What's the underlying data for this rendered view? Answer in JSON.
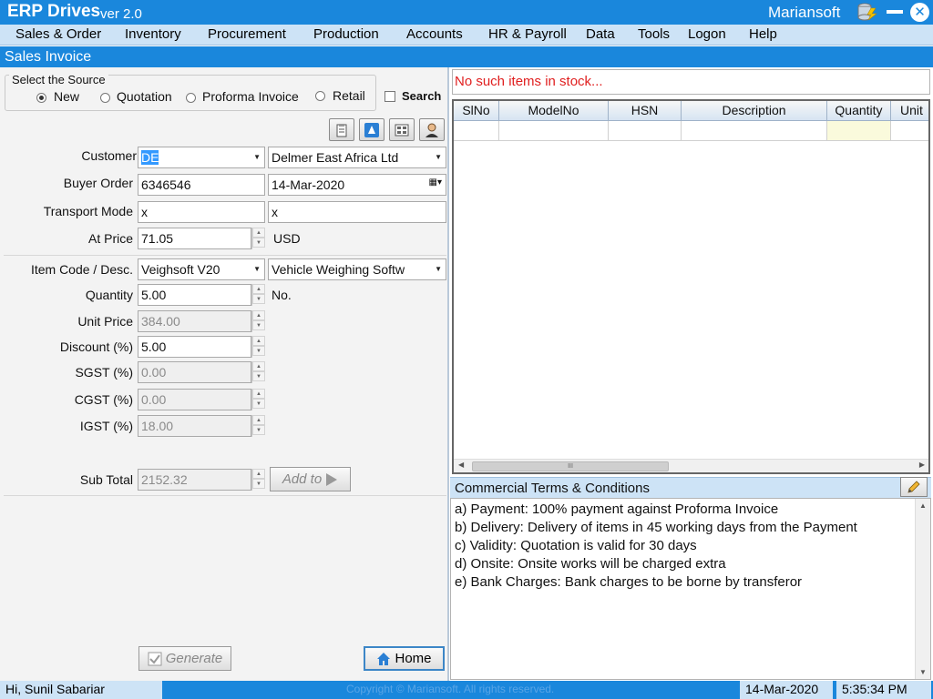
{
  "titlebar": {
    "app_name": "ERP Drives",
    "version": "ver 2.0",
    "brand": "Mariansoft",
    "close_glyph": "✕"
  },
  "menu": [
    "Sales & Order",
    "Inventory",
    "Procurement",
    "Production",
    "Accounts",
    "HR & Payroll",
    "Data",
    "Tools",
    "Logon",
    "Help"
  ],
  "section_title": "Sales Invoice",
  "source": {
    "legend": "Select the Source",
    "options": [
      "New",
      "Quotation",
      "Proforma Invoice",
      "Retail"
    ],
    "selected": "New",
    "search_label": "Search"
  },
  "form": {
    "customer_label": "Customer",
    "customer_code": "DE",
    "customer_name": "Delmer East Africa Ltd",
    "buyer_order_label": "Buyer Order",
    "buyer_order": "6346546",
    "order_date": "14-Mar-2020",
    "transport_label": "Transport Mode",
    "transport_1": "x",
    "transport_2": "x",
    "price_label": "At Price",
    "price": "71.05",
    "currency": "USD",
    "item_label": "Item Code / Desc.",
    "item_code": "Veighsoft V20",
    "item_desc": "Vehicle Weighing Softw",
    "quantity_label": "Quantity",
    "quantity": "5.00",
    "unit": "No.",
    "unit_price_label": "Unit Price",
    "unit_price": "384.00",
    "discount_label": "Discount (%)",
    "discount": "5.00",
    "sgst_label": "SGST (%)",
    "sgst": "0.00",
    "cgst_label": "CGST (%)",
    "cgst": "0.00",
    "igst_label": "IGST (%)",
    "igst": "18.00",
    "subtotal_label": "Sub Total",
    "subtotal": "2152.32",
    "add_label": "Add to"
  },
  "buttons": {
    "generate": "Generate",
    "home": "Home"
  },
  "stock_message": "No such items in stock...",
  "grid": {
    "columns": [
      "SlNo",
      "ModelNo",
      "HSN",
      "Description",
      "Quantity",
      "Unit"
    ],
    "scroll_glyph": "III"
  },
  "terms": {
    "title": "Commercial Terms & Conditions",
    "lines": [
      "a) Payment: 100% payment against Proforma Invoice",
      "b) Delivery: Delivery of items in 45 working days from the Payment",
      "c) Validity: Quotation is valid for 30 days",
      "d) Onsite: Onsite works will be charged extra",
      "e) Bank Charges: Bank charges to be borne by transferor"
    ]
  },
  "status": {
    "user": "Hi, Sunil Sabariar",
    "copyright": "Copyright © Mariansoft. All rights reserved.",
    "date": "14-Mar-2020",
    "time": "5:35:34 PM"
  },
  "colors": {
    "accent": "#1a87dc",
    "light": "#cde3f6",
    "error": "#e01f1f"
  }
}
